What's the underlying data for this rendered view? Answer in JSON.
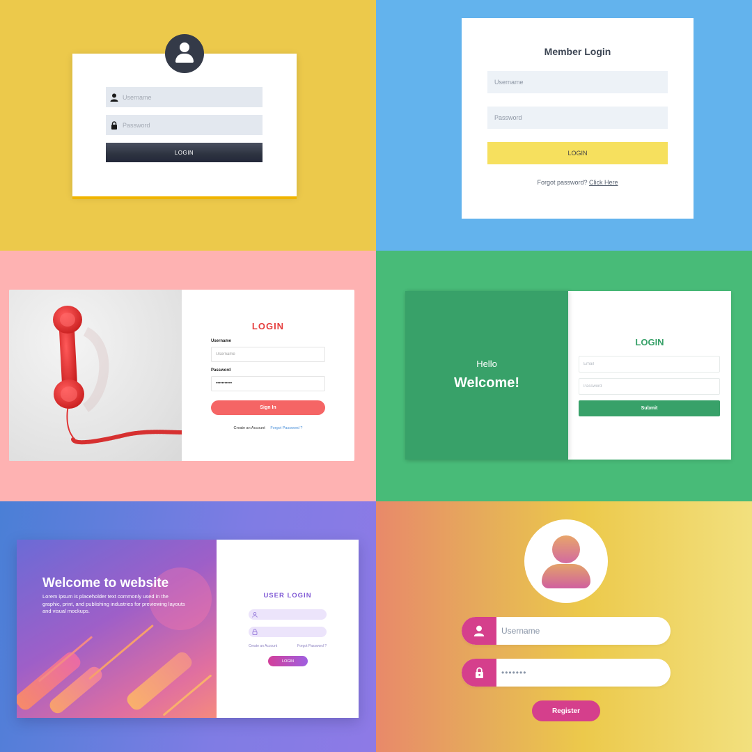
{
  "panel1": {
    "username_placeholder": "Username",
    "password_placeholder": "Password",
    "login_label": "LOGIN",
    "colors": {
      "background": "#ecc94b",
      "avatar": "#343a48",
      "button": "#2d3340"
    },
    "icons": [
      "user-icon",
      "padlock-icon"
    ]
  },
  "panel2": {
    "title": "Member Login",
    "username_placeholder": "Username",
    "password_placeholder": "Password",
    "login_label": "LOGIN",
    "forgot_text": "Forgot password?",
    "forgot_link": "Click Here",
    "colors": {
      "background": "#63b3ed",
      "button": "#f6e05e"
    }
  },
  "panel3": {
    "title": "LOGIN",
    "username_label": "Username",
    "username_placeholder": "Username",
    "password_label": "Password",
    "password_value": "•••••••••••",
    "signin_label": "Sign In",
    "create_account": "Create an Account",
    "forgot_password": "Forgot Password ?",
    "colors": {
      "background": "#feb2b2",
      "accent": "#e53e3e",
      "button": "#f56565"
    },
    "image_icon": "red-telephone-handset-icon"
  },
  "panel4": {
    "hello": "Hello",
    "welcome": "Welcome!",
    "title": "LOGIN",
    "email_placeholder": "Email",
    "password_placeholder": "Password",
    "submit_label": "Submit",
    "colors": {
      "background": "#48bb78",
      "accent": "#38a169"
    }
  },
  "panel5": {
    "art_title": "Welcome to website",
    "art_text": "Lorem ipsum is placeholder text commonly used in the graphic, print, and publishing industries for previewing layouts and visual mockups.",
    "title": "USER LOGIN",
    "create_account": "Create an Account",
    "forgot_password": "Forgot Password ?",
    "login_label": "LOGIN",
    "colors": {
      "accent": "#805ad5",
      "button_from": "#d23f9a",
      "button_to": "#9f5fe0"
    },
    "icons": [
      "user-icon",
      "padlock-icon"
    ]
  },
  "panel6": {
    "username_placeholder": "Username",
    "password_value": "•••••••",
    "register_label": "Register",
    "colors": {
      "accent": "#d53f8c"
    },
    "icons": [
      "avatar-icon",
      "user-icon",
      "padlock-icon"
    ]
  }
}
